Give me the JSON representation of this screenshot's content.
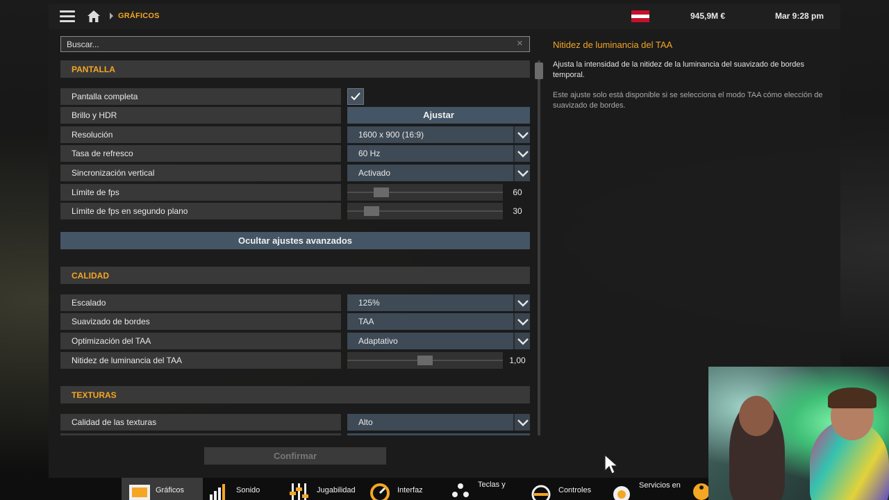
{
  "topbar": {
    "breadcrumb": "GRÁFICOS",
    "money": "945,9M €",
    "clock": "Mar 9:28 pm"
  },
  "search": {
    "placeholder": "Buscar..."
  },
  "sections": {
    "pantalla": "PANTALLA",
    "calidad": "CALIDAD",
    "texturas": "TEXTURAS"
  },
  "settings": {
    "pantalla_completa": {
      "label": "Pantalla completa",
      "checked": true
    },
    "brillo": {
      "label": "Brillo y HDR",
      "button": "Ajustar"
    },
    "resolucion": {
      "label": "Resolución",
      "value": "1600 x 900 (16:9)"
    },
    "tasa": {
      "label": "Tasa de refresco",
      "value": "60 Hz"
    },
    "vsync": {
      "label": "Sincronización vertical",
      "value": "Activado"
    },
    "fps": {
      "label": "Límite de fps",
      "value": "60",
      "level": 0.19
    },
    "fps_bg": {
      "label": "Límite de fps en segundo plano",
      "value": "30",
      "level": 0.12
    },
    "escalado": {
      "label": "Escalado",
      "value": "125%"
    },
    "suavizado": {
      "label": "Suavizado de bordes",
      "value": "TAA"
    },
    "opt_taa": {
      "label": "Optimización del TAA",
      "value": "Adaptativo"
    },
    "nitidez": {
      "label": "Nitidez de luminancia del TAA",
      "value": "1,00",
      "level": 0.5
    },
    "calidad_tex": {
      "label": "Calidad de las texturas",
      "value": "Alto"
    }
  },
  "advanced_button": "Ocultar ajustes avanzados",
  "info": {
    "title": "Nitidez de luminancia del TAA",
    "p1": "Ajusta la intensidad de la nitidez de la luminancia del suavizado de bordes temporal.",
    "p2": "Este ajuste solo está disponible si se selecciona el modo TAA cómo elección de suavizado de bordes."
  },
  "confirm_button": "Confirmar",
  "tabs": [
    "Gráficos",
    "Sonido",
    "Jugabilidad",
    "Interfaz",
    "Teclas y",
    "Controles",
    "Servicios en"
  ],
  "colors": {
    "accent": "#f5a623",
    "button": "#445565",
    "dropdown": "#3e4a56"
  },
  "flag_colors": [
    "#c8102e",
    "#ffffff",
    "#c8102e"
  ]
}
